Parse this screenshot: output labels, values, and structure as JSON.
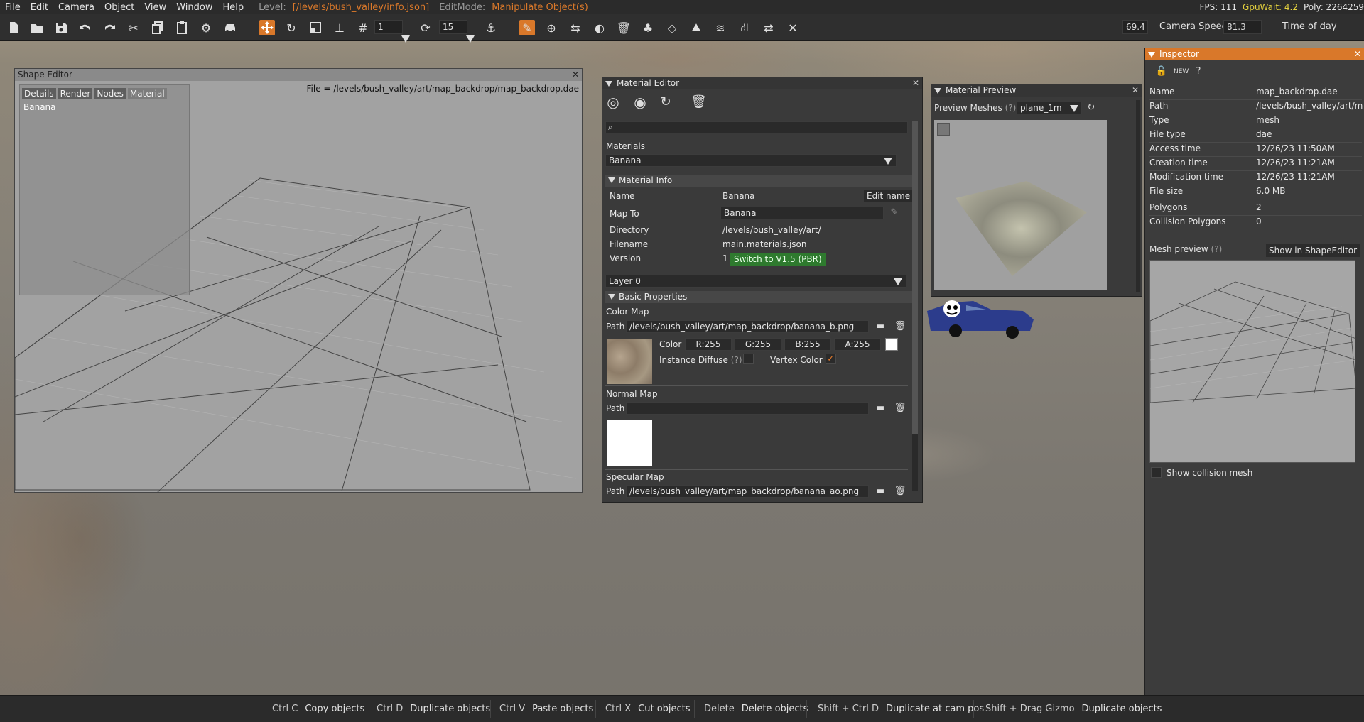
{
  "menu": {
    "items": [
      "File",
      "Edit",
      "Camera",
      "Object",
      "View",
      "Window",
      "Help"
    ],
    "level_label": "Level:",
    "level_value": "[/levels/bush_valley/info.json]",
    "editmode_label": "EditMode:",
    "editmode_value": "Manipulate Object(s)",
    "fps": "FPS: 111",
    "gpuwait": "GpuWait: 4.2",
    "poly": "Poly: 2264259"
  },
  "toolbar": {
    "grid_value": "1",
    "rotate_value": "15",
    "camera_speed_value": "69.4",
    "camera_speed_label": "Camera Speed",
    "time_value": "81.3",
    "time_label": "Time of day"
  },
  "shape_editor": {
    "title": "Shape Editor",
    "file_path": "File = /levels/bush_valley/art/map_backdrop/map_backdrop.dae",
    "tabs": [
      "Details",
      "Render",
      "Nodes",
      "Material"
    ],
    "material_item": "Banana"
  },
  "material_editor": {
    "title": "Material Editor",
    "search_placeholder": "",
    "materials_label": "Materials",
    "materials_selected": "Banana",
    "material_info_header": "Material Info",
    "name_label": "Name",
    "name_value": "Banana",
    "edit_name_button": "Edit name",
    "mapto_label": "Map To",
    "mapto_value": "Banana",
    "directory_label": "Directory",
    "directory_value": "/levels/bush_valley/art/",
    "filename_label": "Filename",
    "filename_value": "main.materials.json",
    "version_label": "Version",
    "version_value": "1",
    "switch_button": "Switch to V1.5 (PBR)",
    "layer_selected": "Layer 0",
    "basic_header": "Basic Properties",
    "color_map_label": "Color Map",
    "path_label": "Path",
    "color_map_path": "/levels/bush_valley/art/map_backdrop/banana_b.png",
    "color_label": "Color",
    "r": "R:255",
    "g": "G:255",
    "b": "B:255",
    "a": "A:255",
    "instance_diffuse_label": "Instance Diffuse",
    "help_mark": "(?)",
    "vertex_color_label": "Vertex Color",
    "normal_map_label": "Normal Map",
    "normal_map_path": "",
    "specular_map_label": "Specular Map",
    "specular_map_path": "/levels/bush_valley/art/map_backdrop/banana_ao.png"
  },
  "material_preview": {
    "title": "Material Preview",
    "meshes_label": "Preview Meshes",
    "help_mark": "(?)",
    "mesh_selected": "plane_1m"
  },
  "inspector": {
    "title": "Inspector",
    "props": [
      {
        "k": "Name",
        "v": "map_backdrop.dae"
      },
      {
        "k": "Path",
        "v": "/levels/bush_valley/art/map_backdrop/map_backdrop.dae"
      },
      {
        "k": "Type",
        "v": "mesh"
      },
      {
        "k": "File type",
        "v": "dae"
      },
      {
        "k": "Access time",
        "v": "12/26/23 11:50AM"
      },
      {
        "k": "Creation time",
        "v": "12/26/23 11:21AM"
      },
      {
        "k": "Modification time",
        "v": "12/26/23 11:21AM"
      },
      {
        "k": "File size",
        "v": "6.0 MB"
      },
      {
        "k": "Polygons",
        "v": "2"
      },
      {
        "k": "Collision Polygons",
        "v": "0"
      }
    ],
    "mesh_preview_label": "Mesh preview",
    "help_mark": "(?)",
    "show_in_shape_editor": "Show in ShapeEditor",
    "show_collision_mesh": "Show collision mesh"
  },
  "statusbar": [
    {
      "key": "Ctrl C",
      "action": "Copy objects"
    },
    {
      "key": "Ctrl D",
      "action": "Duplicate objects"
    },
    {
      "key": "Ctrl V",
      "action": "Paste objects"
    },
    {
      "key": "Ctrl X",
      "action": "Cut objects"
    },
    {
      "key": "Delete",
      "action": "Delete objects"
    },
    {
      "key": "Shift + Ctrl D",
      "action": "Duplicate at cam pos"
    },
    {
      "key": "Shift + Drag Gizmo",
      "action": "Duplicate objects"
    }
  ],
  "colors": {
    "accent": "#d9782a",
    "green_button": "#2e7a2e",
    "gpuwait": "#e5d23e"
  }
}
